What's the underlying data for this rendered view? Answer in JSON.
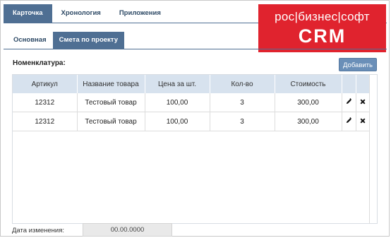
{
  "top_tabs": [
    {
      "label": "Карточка",
      "active": true
    },
    {
      "label": "Хронология",
      "active": false
    },
    {
      "label": "Приложения",
      "active": false
    }
  ],
  "sub_tabs": [
    {
      "label": "Основная",
      "active": false
    },
    {
      "label": "Смета по проекту",
      "active": true
    }
  ],
  "logo": {
    "top": "рос|бизнес|софт",
    "bottom": "CRM",
    "color": "#e0232e"
  },
  "section": {
    "label": "Номенклатура:",
    "add_button": "Добавить"
  },
  "table": {
    "columns": [
      "Артикул",
      "Название товара",
      "Цена за шт.",
      "Кол-во",
      "Стоимость"
    ],
    "rows": [
      [
        "12312",
        "Тестовый товар",
        "100,00",
        "3",
        "300,00"
      ],
      [
        "12312",
        "Тестовый товар",
        "100,00",
        "3",
        "300,00"
      ]
    ],
    "edit_icon": "pencil-icon",
    "delete_icon": "close-icon"
  },
  "date": {
    "label": "Дата изменения:",
    "value": "00.00.0000"
  },
  "colors": {
    "accent": "#4f6f93",
    "header": "#d7e2ee",
    "button": "#6a8fb8"
  }
}
